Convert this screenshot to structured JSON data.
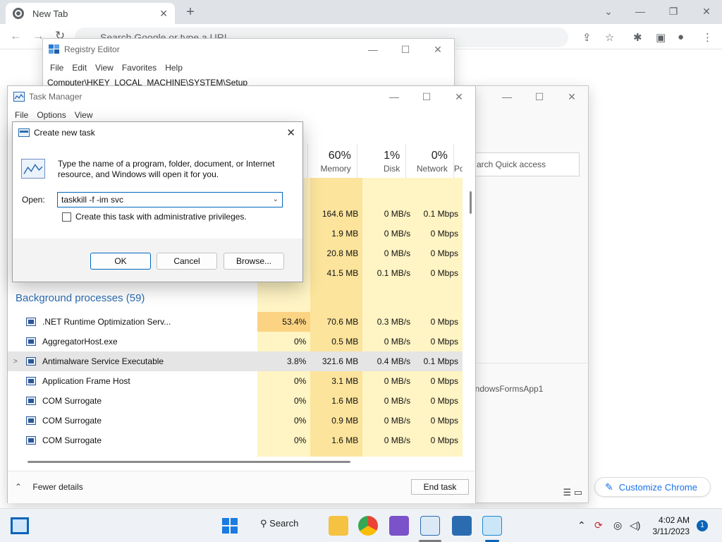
{
  "chrome": {
    "tab_title": "New Tab",
    "omnibox_placeholder": "Search Google or type a URL",
    "customize_label": "Customize Chrome",
    "icons": [
      "chrome-icon",
      "back-icon",
      "forward-icon",
      "reload-icon",
      "share-icon",
      "star-icon",
      "extensions-icon",
      "sidepanel-icon",
      "profile-icon",
      "menu-icon"
    ]
  },
  "regedit": {
    "title": "Registry Editor",
    "menu": [
      "File",
      "Edit",
      "View",
      "Favorites",
      "Help"
    ],
    "address": "Computer\\HKEY_LOCAL_MACHINE\\SYSTEM\\Setup"
  },
  "explorer": {
    "quick_access": "arch Quick access",
    "item": "indowsFormsApp1"
  },
  "taskmgr": {
    "title": "Task Manager",
    "menu": [
      "File",
      "Options",
      "View"
    ],
    "columns": [
      {
        "pct": "60%",
        "label": "Memory"
      },
      {
        "pct": "1%",
        "label": "Disk"
      },
      {
        "pct": "0%",
        "label": "Network"
      },
      {
        "pct": "",
        "label": "Po"
      }
    ],
    "apps_rows": [
      {
        "cpu": "",
        "memory": "164.6 MB",
        "disk": "0 MB/s",
        "network": "0.1 Mbps"
      },
      {
        "cpu": "",
        "memory": "1.9 MB",
        "disk": "0 MB/s",
        "network": "0 Mbps"
      },
      {
        "cpu": "",
        "memory": "20.8 MB",
        "disk": "0 MB/s",
        "network": "0 Mbps"
      },
      {
        "cpu": "",
        "memory": "41.5 MB",
        "disk": "0.1 MB/s",
        "network": "0 Mbps"
      }
    ],
    "background_header": "Background processes (59)",
    "bg_rows": [
      {
        "name": ".NET Runtime Optimization Serv...",
        "cpu": "53.4%",
        "memory": "70.6 MB",
        "disk": "0.3 MB/s",
        "network": "0 Mbps",
        "expand": ""
      },
      {
        "name": "AggregatorHost.exe",
        "cpu": "0%",
        "memory": "0.5 MB",
        "disk": "0 MB/s",
        "network": "0 Mbps",
        "expand": ""
      },
      {
        "name": "Antimalware Service Executable",
        "cpu": "3.8%",
        "memory": "321.6 MB",
        "disk": "0.4 MB/s",
        "network": "0.1 Mbps",
        "expand": ">"
      },
      {
        "name": "Application Frame Host",
        "cpu": "0%",
        "memory": "3.1 MB",
        "disk": "0 MB/s",
        "network": "0 Mbps",
        "expand": ""
      },
      {
        "name": "COM Surrogate",
        "cpu": "0%",
        "memory": "1.6 MB",
        "disk": "0 MB/s",
        "network": "0 Mbps",
        "expand": ""
      },
      {
        "name": "COM Surrogate",
        "cpu": "0%",
        "memory": "0.9 MB",
        "disk": "0 MB/s",
        "network": "0 Mbps",
        "expand": ""
      },
      {
        "name": "COM Surrogate",
        "cpu": "0%",
        "memory": "1.6 MB",
        "disk": "0 MB/s",
        "network": "0 Mbps",
        "expand": ""
      }
    ],
    "fewer_details": "Fewer details",
    "end_task": "End task"
  },
  "dialog": {
    "title": "Create new task",
    "description": "Type the name of a program, folder, document, or Internet resource, and Windows will open it for you.",
    "open_label": "Open:",
    "open_value": "taskkill -f -im svc",
    "admin_checkbox": "Create this task with administrative privileges.",
    "admin_checked": false,
    "ok": "OK",
    "cancel": "Cancel",
    "browse": "Browse..."
  },
  "taskbar": {
    "search_label": "Search",
    "time": "4:02 AM",
    "date": "3/11/2023",
    "notification_count": "1"
  },
  "colors": {
    "heat_light": "#fff4c4",
    "heat_mid": "#fce49c",
    "heat_hot": "#fbd382",
    "accent": "#0067c0",
    "link_blue": "#2b6cb0"
  }
}
